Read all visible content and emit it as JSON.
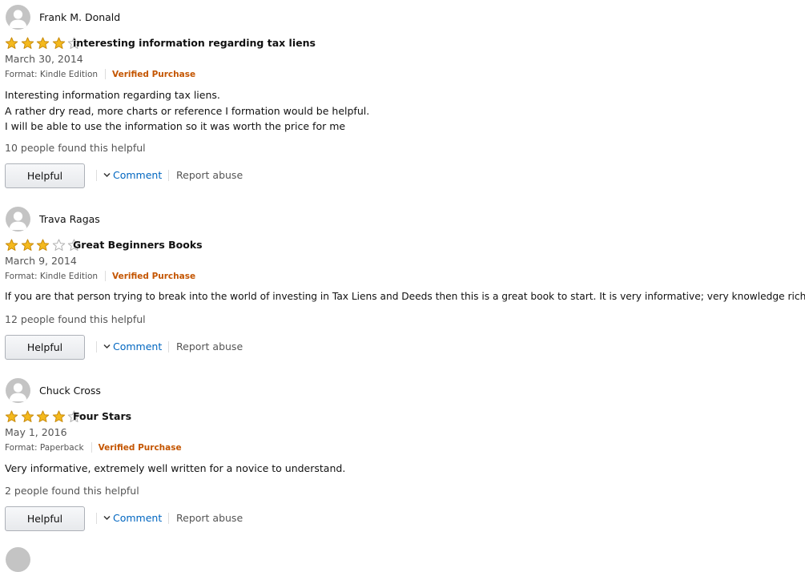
{
  "reviews": [
    {
      "author": "Frank M. Donald",
      "rating": 4,
      "title": "interesting information regarding tax liens",
      "date": "March 30, 2014",
      "format": "Format: Kindle Edition",
      "verified": "Verified Purchase",
      "body": [
        "Interesting information regarding tax liens.",
        "A rather dry read, more charts or reference I formation would be helpful.",
        "I will be able to use the information so it was worth the price for me"
      ],
      "helpful_count": "10 people found this helpful",
      "helpful_label": "Helpful",
      "comment_label": "Comment",
      "abuse_label": "Report abuse"
    },
    {
      "author": "Trava Ragas",
      "rating": 3,
      "title": "Great Beginners Books",
      "date": "March 9, 2014",
      "format": "Format: Kindle Edition",
      "verified": "Verified Purchase",
      "body": [
        "If you are that person trying to break into the world of investing in Tax Liens and Deeds then this is a great book to start. It is very informative; very knowledge rich book."
      ],
      "helpful_count": "12 people found this helpful",
      "helpful_label": "Helpful",
      "comment_label": "Comment",
      "abuse_label": "Report abuse"
    },
    {
      "author": "Chuck Cross",
      "rating": 4,
      "title": "Four Stars",
      "date": "May 1, 2016",
      "format": "Format: Paperback",
      "verified": "Verified Purchase",
      "body": [
        "Very informative, extremely well written for a novice to understand."
      ],
      "helpful_count": "2 people found this helpful",
      "helpful_label": "Helpful",
      "comment_label": "Comment",
      "abuse_label": "Report abuse"
    }
  ],
  "icons": {
    "avatar": "default-avatar-icon",
    "star": "star-icon",
    "chevron": "chevron-down-icon"
  },
  "colors": {
    "star_fill": "#f4b91d",
    "star_stroke": "#c88b0c",
    "star_empty": "#ffffff",
    "verified": "#c45500",
    "link": "#0066c0",
    "muted": "#555555"
  }
}
